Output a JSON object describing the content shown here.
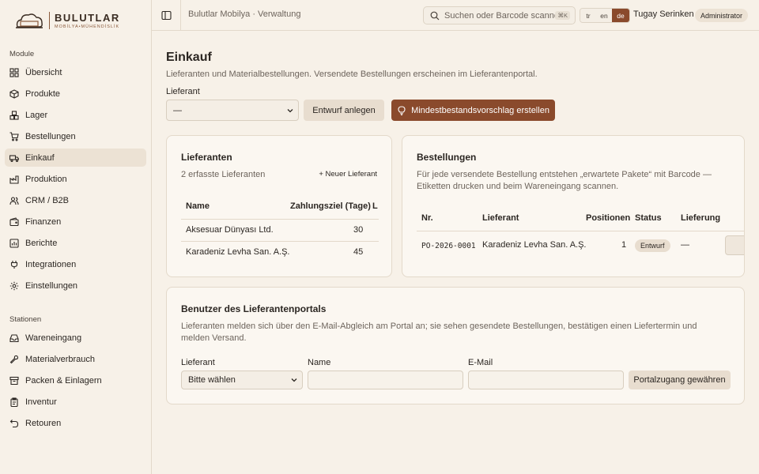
{
  "brand": {
    "name": "BULUTLAR",
    "tagline": "MOBİLYA•MÜHENDİSLİK"
  },
  "sidebar": {
    "modules_label": "Module",
    "modules": [
      {
        "label": "Übersicht",
        "icon": "dashboard-icon"
      },
      {
        "label": "Produkte",
        "icon": "package-icon"
      },
      {
        "label": "Lager",
        "icon": "boxes-icon"
      },
      {
        "label": "Bestellungen",
        "icon": "cart-icon"
      },
      {
        "label": "Einkauf",
        "icon": "truck-icon",
        "active": true
      },
      {
        "label": "Produktion",
        "icon": "factory-icon"
      },
      {
        "label": "CRM / B2B",
        "icon": "users-icon"
      },
      {
        "label": "Finanzen",
        "icon": "wallet-icon"
      },
      {
        "label": "Berichte",
        "icon": "chart-icon"
      },
      {
        "label": "Integrationen",
        "icon": "plug-icon"
      },
      {
        "label": "Einstellungen",
        "icon": "gear-icon"
      }
    ],
    "stations_label": "Stationen",
    "stations": [
      {
        "label": "Wareneingang",
        "icon": "inbox-icon"
      },
      {
        "label": "Materialverbrauch",
        "icon": "wrench-icon"
      },
      {
        "label": "Packen & Einlagern",
        "icon": "archive-icon"
      },
      {
        "label": "Inventur",
        "icon": "clipboard-icon"
      },
      {
        "label": "Retouren",
        "icon": "undo-icon"
      }
    ]
  },
  "topbar": {
    "app_title": "Bulutlar Mobilya · Verwaltung",
    "search_placeholder": "Suchen oder Barcode scannen",
    "search_shortcut": "⌘K",
    "languages": [
      "tr",
      "en",
      "de"
    ],
    "active_language": "de",
    "user_name": "Tugay Serinken",
    "user_role": "Administrator"
  },
  "page": {
    "title": "Einkauf",
    "subtitle": "Lieferanten und Materialbestellungen. Versendete Bestellungen erscheinen im Lieferantenportal.",
    "supplier_label": "Lieferant",
    "supplier_value": "—",
    "draft_button": "Entwurf anlegen",
    "suggest_button": "Mindestbestandsvorschlag erstellen"
  },
  "suppliers_card": {
    "title": "Lieferanten",
    "count_text": "2 erfasste Lieferanten",
    "new_button": "+ Neuer Lieferant",
    "columns": [
      "Name",
      "Zahlungsziel (Tage)",
      "L"
    ],
    "rows": [
      {
        "name": "Aksesuar Dünyası Ltd.",
        "terms": "30"
      },
      {
        "name": "Karadeniz Levha San. A.Ş.",
        "terms": "45"
      }
    ]
  },
  "orders_card": {
    "title": "Bestellungen",
    "description": "Für jede versendete Bestellung entstehen „erwartete Pakete“ mit Barcode — Etiketten drucken und beim Wareneingang scannen.",
    "columns": [
      "Nr.",
      "Lieferant",
      "Positionen",
      "Status",
      "Lieferung"
    ],
    "rows": [
      {
        "nr": "PO-2026-0001",
        "supplier": "Karadeniz Levha San. A.Ş.",
        "positions": "1",
        "status": "Entwurf",
        "delivery": "—"
      }
    ]
  },
  "portal_card": {
    "title": "Benutzer des Lieferantenportals",
    "description": "Lieferanten melden sich über den E-Mail-Abgleich am Portal an; sie sehen gesendete Bestellungen, bestätigen einen Liefertermin und melden Versand.",
    "supplier_label": "Lieferant",
    "supplier_placeholder": "Bitte wählen",
    "name_label": "Name",
    "email_label": "E-Mail",
    "grant_button": "Portalzugang gewähren"
  }
}
